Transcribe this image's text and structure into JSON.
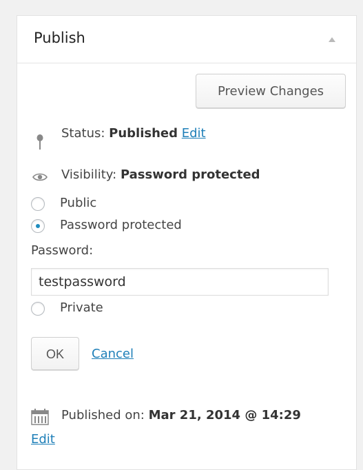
{
  "box": {
    "title": "Publish"
  },
  "preview_button": "Preview Changes",
  "status": {
    "label": "Status:",
    "value": "Published",
    "edit_link": "Edit"
  },
  "visibility": {
    "label": "Visibility:",
    "value": "Password protected",
    "options": [
      {
        "label": "Public",
        "checked": false
      },
      {
        "label": "Password protected",
        "checked": true
      },
      {
        "label": "Private",
        "checked": false
      }
    ],
    "password_label": "Password:",
    "password_value": "testpassword",
    "ok_button": "OK",
    "cancel_link": "Cancel"
  },
  "published_on": {
    "label": "Published on:",
    "value": "Mar 21, 2014 @ 14:29",
    "edit_link": "Edit"
  },
  "icons": {
    "status": "pin-icon",
    "visibility": "eye-icon",
    "date": "calendar-icon",
    "toggle": "collapse-arrow-icon"
  },
  "colors": {
    "link": "#1e7fb8",
    "radio_checked": "#1e8cbe"
  }
}
